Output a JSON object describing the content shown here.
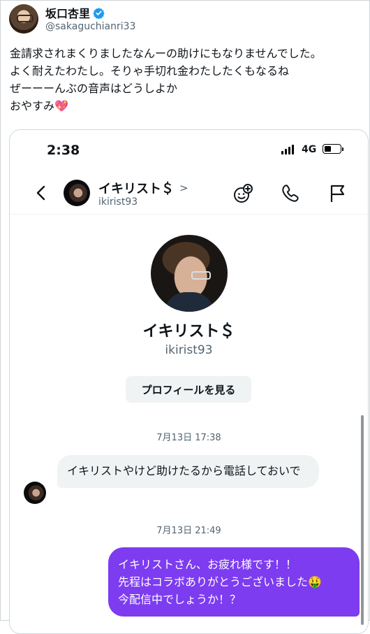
{
  "tweet": {
    "author_name": "坂口杏里",
    "author_handle": "@sakaguchianri33",
    "text": "金請求されまくりましたなんーの助けにもなりませんでした。\nよく耐えたわたし。そりゃ手切れ金わたしたくもなるね\nぜーーーんぶの音声はどうしよか\nおやすみ",
    "emoji": "💖"
  },
  "phone": {
    "time": "2:38",
    "network": "4G",
    "chat": {
      "name": "イキリスト＄",
      "handle": "ikirist93",
      "profile_name": "イキリスト＄",
      "profile_handle": "ikirist93",
      "view_profile_label": "プロフィールを見る",
      "timestamp_1": "7月13日 17:38",
      "incoming_message": "イキリストやけど助けたるから電話しておいで",
      "timestamp_2": "7月13日 21:49",
      "outgoing_message": "イキリストさん、お疲れ様です！！\n先程はコラボありがとうございました🤑\n今配信中でしょうか！？"
    }
  },
  "colors": {
    "accent": "#7d3cf0",
    "verified": "#1d9bf0"
  },
  "icons": [
    "verified-badge-icon",
    "back-arrow-icon",
    "chevron-right-icon",
    "emoji-add-icon",
    "phone-icon",
    "flag-icon",
    "signal-icon",
    "battery-icon"
  ]
}
